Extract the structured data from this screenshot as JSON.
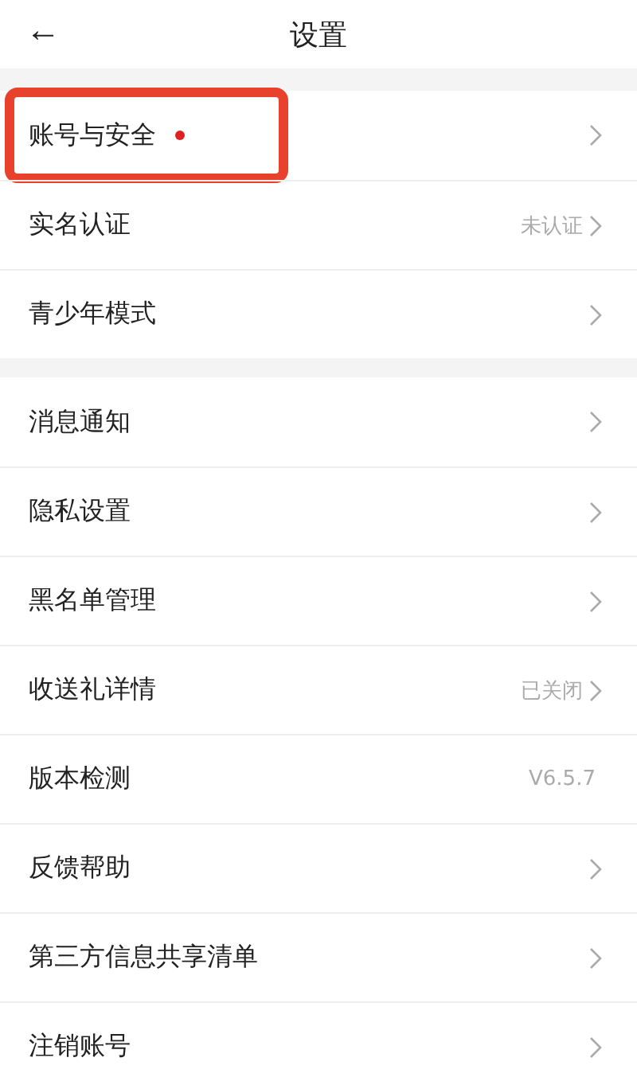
{
  "header": {
    "back": "←",
    "title": "设置"
  },
  "sections": [
    {
      "items": [
        {
          "label": "账号与安全",
          "dot": true,
          "highlighted": true,
          "chevron": true
        },
        {
          "label": "实名认证",
          "value": "未认证",
          "dot": false,
          "highlighted": false,
          "chevron": true
        },
        {
          "label": "青少年模式",
          "dot": false,
          "highlighted": false,
          "chevron": true
        }
      ]
    },
    {
      "items": [
        {
          "label": "消息通知",
          "dot": false,
          "highlighted": false,
          "chevron": true
        },
        {
          "label": "隐私设置",
          "dot": false,
          "highlighted": false,
          "chevron": true
        },
        {
          "label": "黑名单管理",
          "dot": false,
          "highlighted": false,
          "chevron": true
        },
        {
          "label": "收送礼详情",
          "value": "已关闭",
          "dot": false,
          "highlighted": false,
          "chevron": true
        },
        {
          "label": "版本检测",
          "value": "V6.5.7",
          "dot": false,
          "highlighted": false,
          "chevron": false
        },
        {
          "label": "反馈帮助",
          "dot": false,
          "highlighted": false,
          "chevron": true
        },
        {
          "label": "第三方信息共享清单",
          "dot": false,
          "highlighted": false,
          "chevron": true
        },
        {
          "label": "注销账号",
          "dot": false,
          "highlighted": false,
          "chevron": true
        }
      ]
    }
  ]
}
